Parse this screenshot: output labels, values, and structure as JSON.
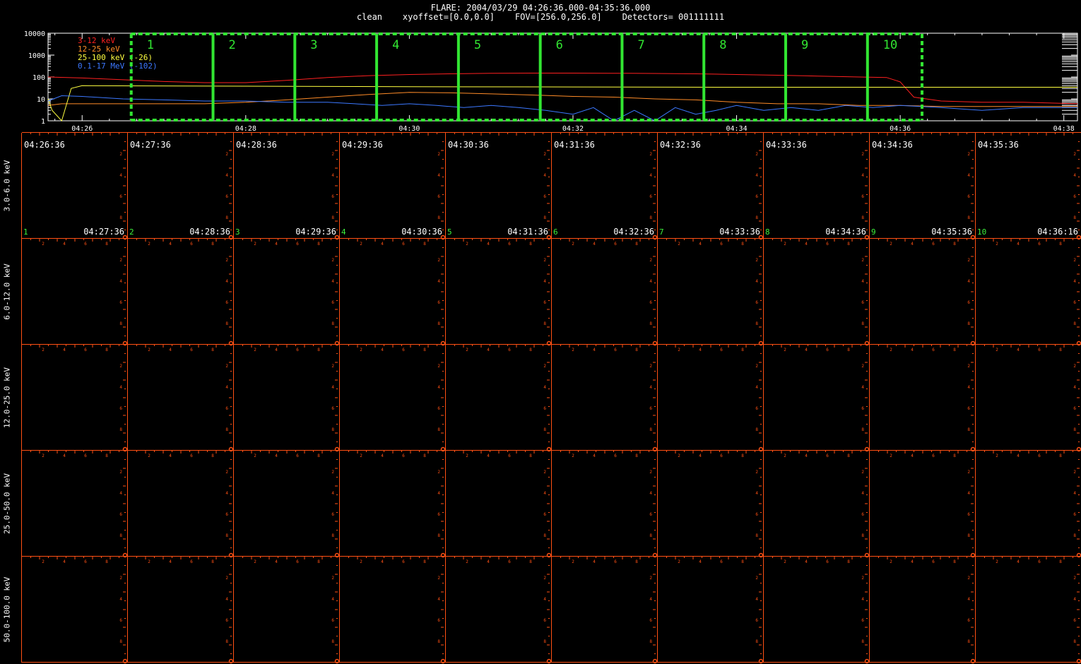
{
  "header": {
    "title": "FLARE: 2004/03/29 04:26:36.000-04:35:36.000",
    "subtitle": "clean    xyoffset=[0.0,0.0]    FOV=[256.0,256.0]    Detectors= 001111111"
  },
  "chart_data": [
    {
      "type": "line",
      "yscale": "log",
      "ylim": [
        1,
        10000
      ],
      "ytick_labels": [
        "10000",
        "1000",
        "100",
        "10",
        "1"
      ],
      "xlim": [
        "04:25:35",
        "04:38:10"
      ],
      "xtick_labels": [
        "04:26",
        "04:28",
        "04:30",
        "04:32",
        "04:34",
        "04:36",
        "04:38"
      ],
      "legend_placement": "top-left",
      "series": [
        {
          "name": "3-12 keV",
          "color": "#ff2020",
          "x": [
            "04:25:35",
            "04:26:00",
            "04:26:30",
            "04:27:00",
            "04:27:30",
            "04:28:00",
            "04:28:30",
            "04:29:00",
            "04:29:30",
            "04:30:00",
            "04:30:30",
            "04:31:00",
            "04:31:30",
            "04:32:00",
            "04:32:30",
            "04:33:00",
            "04:33:30",
            "04:34:00",
            "04:34:30",
            "04:35:00",
            "04:35:30",
            "04:35:50",
            "04:36:00",
            "04:36:10",
            "04:36:30",
            "04:37:00",
            "04:37:30",
            "04:38:10"
          ],
          "values": [
            100,
            90,
            75,
            62,
            55,
            55,
            70,
            95,
            115,
            130,
            140,
            148,
            150,
            150,
            148,
            145,
            140,
            130,
            120,
            110,
            100,
            95,
            60,
            12,
            8,
            7,
            7,
            6
          ]
        },
        {
          "name": "12-25 keV",
          "color": "#ff8c28",
          "x": [
            "04:25:35",
            "04:25:45",
            "04:26:00",
            "04:26:30",
            "04:27:00",
            "04:27:30",
            "04:28:00",
            "04:28:30",
            "04:29:00",
            "04:29:30",
            "04:30:00",
            "04:30:30",
            "04:31:00",
            "04:31:30",
            "04:32:00",
            "04:32:30",
            "04:33:00",
            "04:33:30",
            "04:34:00",
            "04:34:30",
            "04:35:00",
            "04:35:30",
            "04:36:00",
            "04:36:30",
            "04:37:00",
            "04:37:30",
            "04:38:10"
          ],
          "values": [
            5,
            6,
            6,
            6,
            6,
            6,
            7,
            9,
            12,
            16,
            20,
            19,
            17,
            15,
            13,
            12,
            10,
            9,
            7,
            6,
            6,
            5,
            5,
            4.5,
            4.5,
            4.5,
            4.5
          ]
        },
        {
          "name": "25-100 keV (-26)",
          "color": "#ffff40",
          "x": [
            "04:25:35",
            "04:25:38",
            "04:25:45",
            "04:25:52",
            "04:26:00",
            "04:28:00",
            "04:30:00",
            "04:32:00",
            "04:34:00",
            "04:36:00",
            "04:38:10"
          ],
          "values": [
            10,
            3,
            1,
            30,
            40,
            38,
            36,
            35,
            34,
            34,
            34
          ]
        },
        {
          "name": "0.1-17 MeV (-102)",
          "color": "#3c78ff",
          "x": [
            "04:25:35",
            "04:25:45",
            "04:26:00",
            "04:26:30",
            "04:27:00",
            "04:27:30",
            "04:28:00",
            "04:28:30",
            "04:29:00",
            "04:29:20",
            "04:29:40",
            "04:30:00",
            "04:30:20",
            "04:30:40",
            "04:31:00",
            "04:31:20",
            "04:31:40",
            "04:32:00",
            "04:32:15",
            "04:32:30",
            "04:32:45",
            "04:33:00",
            "04:33:15",
            "04:33:30",
            "04:33:45",
            "04:34:00",
            "04:34:20",
            "04:34:40",
            "04:35:00",
            "04:35:20",
            "04:35:40",
            "04:36:00",
            "04:36:30",
            "04:37:00",
            "04:37:30",
            "04:38:10"
          ],
          "values": [
            8,
            14,
            13,
            10,
            9,
            8,
            8,
            7,
            7,
            6,
            5,
            6,
            5,
            4,
            5,
            4,
            3,
            2,
            4,
            1,
            3,
            1,
            4,
            2,
            3,
            5,
            3,
            4,
            3,
            5,
            4,
            5,
            4,
            3,
            4,
            4
          ]
        }
      ],
      "intervals": {
        "color": "#32e632",
        "labels": [
          "1",
          "2",
          "3",
          "4",
          "5",
          "6",
          "7",
          "8",
          "9",
          "10"
        ],
        "boundaries": [
          "04:26:36",
          "04:27:36",
          "04:28:36",
          "04:29:36",
          "04:30:36",
          "04:31:36",
          "04:32:36",
          "04:33:36",
          "04:34:36",
          "04:35:36",
          "04:36:16"
        ]
      }
    },
    {
      "type": "image-grid",
      "axis_color": "#ff5014",
      "row_labels": [
        "3.0-6.0 keV",
        "6.0-12.0 keV",
        "12.0-25.0 keV",
        "25.0-50.0 keV",
        "50.0-100.0 keV"
      ],
      "column_start_times": [
        "04:26:36",
        "04:27:36",
        "04:28:36",
        "04:29:36",
        "04:30:36",
        "04:31:36",
        "04:32:36",
        "04:33:36",
        "04:34:36",
        "04:35:36"
      ],
      "column_end_times": [
        "04:27:36",
        "04:28:36",
        "04:29:36",
        "04:30:36",
        "04:31:36",
        "04:32:36",
        "04:33:36",
        "04:34:36",
        "04:35:36",
        "04:36:16"
      ],
      "column_indices": [
        "1",
        "2",
        "3",
        "4",
        "5",
        "6",
        "7",
        "8",
        "9",
        "10"
      ],
      "tick_labels": [
        "2",
        "4",
        "6",
        "8"
      ]
    }
  ]
}
